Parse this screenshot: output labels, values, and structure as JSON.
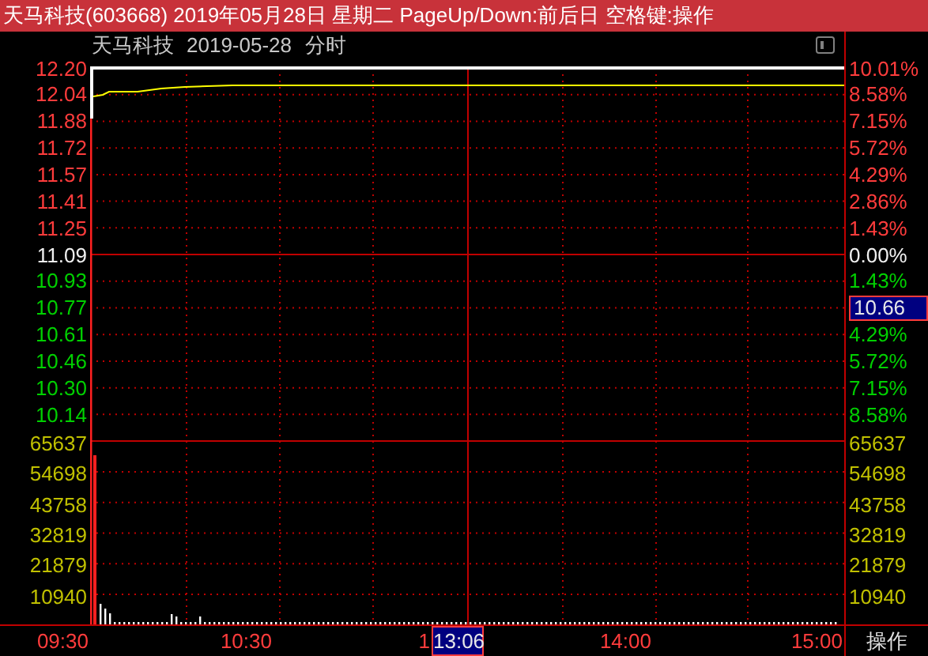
{
  "title_bar": {
    "text": "天马科技(603668) 2019年05月28日 星期二 PageUp/Down:前后日 空格键:操作"
  },
  "chart_header": {
    "stock_name": "天马科技",
    "date": "2019-05-28",
    "mode": "分时"
  },
  "left_axis": [
    {
      "label": "12.20",
      "kind": "up"
    },
    {
      "label": "12.04",
      "kind": "up"
    },
    {
      "label": "11.88",
      "kind": "up"
    },
    {
      "label": "11.72",
      "kind": "up"
    },
    {
      "label": "11.57",
      "kind": "up"
    },
    {
      "label": "11.41",
      "kind": "up"
    },
    {
      "label": "11.25",
      "kind": "up"
    },
    {
      "label": "11.09",
      "kind": "flat"
    },
    {
      "label": "10.93",
      "kind": "down"
    },
    {
      "label": "10.77",
      "kind": "down"
    },
    {
      "label": "10.61",
      "kind": "down"
    },
    {
      "label": "10.46",
      "kind": "down"
    },
    {
      "label": "10.30",
      "kind": "down"
    },
    {
      "label": "10.14",
      "kind": "down"
    },
    {
      "label": "65637",
      "kind": "volume"
    },
    {
      "label": "54698",
      "kind": "volume"
    },
    {
      "label": "43758",
      "kind": "volume"
    },
    {
      "label": "32819",
      "kind": "volume"
    },
    {
      "label": "21879",
      "kind": "volume"
    },
    {
      "label": "10940",
      "kind": "volume"
    }
  ],
  "right_axis": [
    {
      "label": "10.01%",
      "kind": "up"
    },
    {
      "label": "8.58%",
      "kind": "up"
    },
    {
      "label": "7.15%",
      "kind": "up"
    },
    {
      "label": "5.72%",
      "kind": "up"
    },
    {
      "label": "4.29%",
      "kind": "up"
    },
    {
      "label": "2.86%",
      "kind": "up"
    },
    {
      "label": "1.43%",
      "kind": "up"
    },
    {
      "label": "0.00%",
      "kind": "flat"
    },
    {
      "label": "1.43%",
      "kind": "down"
    },
    {
      "label": "10.66",
      "kind": "cursor"
    },
    {
      "label": "4.29%",
      "kind": "down"
    },
    {
      "label": "5.72%",
      "kind": "down"
    },
    {
      "label": "7.15%",
      "kind": "down"
    },
    {
      "label": "8.58%",
      "kind": "down"
    },
    {
      "label": "65637",
      "kind": "volume"
    },
    {
      "label": "54698",
      "kind": "volume"
    },
    {
      "label": "43758",
      "kind": "volume"
    },
    {
      "label": "32819",
      "kind": "volume"
    },
    {
      "label": "21879",
      "kind": "volume"
    },
    {
      "label": "10940",
      "kind": "volume"
    }
  ],
  "time_axis": [
    {
      "label": "09:30",
      "kind": "time"
    },
    {
      "label": "10:30",
      "kind": "time"
    },
    {
      "label": "1",
      "kind": "time"
    },
    {
      "label": "13:06",
      "kind": "cursor"
    },
    {
      "label": "14:00",
      "kind": "time"
    },
    {
      "label": "15:00",
      "kind": "time"
    },
    {
      "label": "操作",
      "kind": "action"
    }
  ]
}
